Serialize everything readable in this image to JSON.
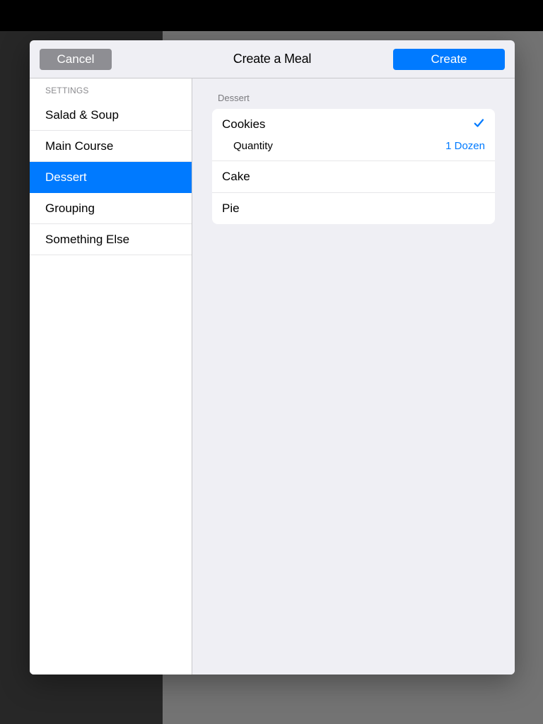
{
  "header": {
    "cancel": "Cancel",
    "title": "Create a Meal",
    "create": "Create"
  },
  "sidebar": {
    "section": "SETTINGS",
    "items": [
      {
        "label": "Salad & Soup"
      },
      {
        "label": "Main Course"
      },
      {
        "label": "Dessert",
        "selected": true
      },
      {
        "label": "Grouping"
      },
      {
        "label": "Something Else"
      }
    ]
  },
  "detail": {
    "section": "Dessert",
    "rows": [
      {
        "label": "Cookies",
        "selected": true,
        "quantity_label": "Quantity",
        "quantity_value": "1 Dozen"
      },
      {
        "label": "Cake"
      },
      {
        "label": "Pie"
      }
    ]
  }
}
